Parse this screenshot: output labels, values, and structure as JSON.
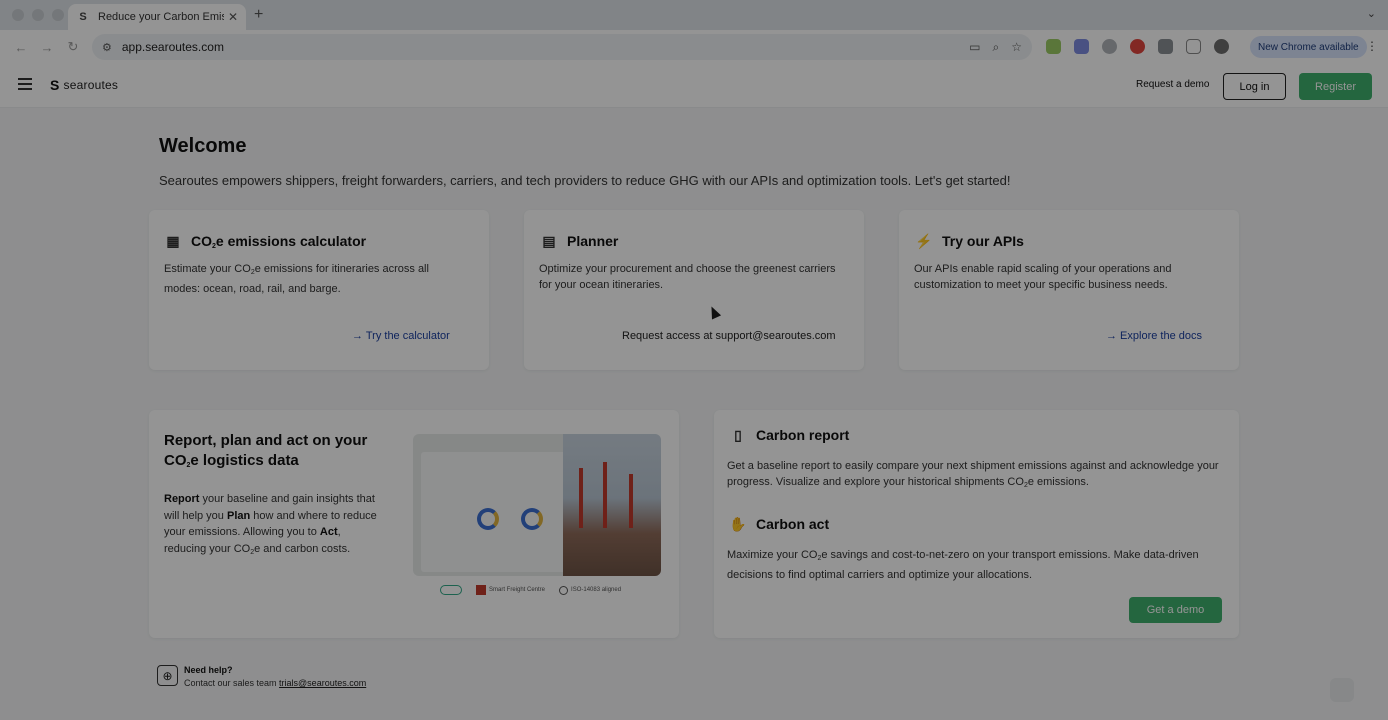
{
  "browser": {
    "tab_title": "Reduce your Carbon Emissio",
    "url": "app.searoutes.com",
    "update_label": "New Chrome available"
  },
  "header": {
    "brand": "searoutes",
    "request_demo": "Request a demo",
    "login": "Log in",
    "register": "Register"
  },
  "main": {
    "title": "Welcome",
    "subtitle": "Searoutes empowers shippers, freight forwarders, carriers, and tech providers to reduce GHG with our APIs and optimization tools. Let's get started!"
  },
  "cards": [
    {
      "title_pre": "CO",
      "title_sub": "2",
      "title_post": "e emissions calculator",
      "desc_pre": "Estimate your CO",
      "desc_sub": "2",
      "desc_post": "e emissions for itineraries across all modes: ocean, road, rail, and barge.",
      "link": "→ Try the calculator"
    },
    {
      "title": "Planner",
      "desc": "Optimize your procurement and choose the greenest carriers for your ocean itineraries.",
      "link": "Request access at support@searoutes.com"
    },
    {
      "title": "Try our APIs",
      "desc": "Our APIs enable rapid scaling of your operations and customization to meet your specific business needs.",
      "link": "→ Explore the docs"
    }
  ],
  "report_section": {
    "title_pre": "Report, plan and act on your CO",
    "title_sub": "2",
    "title_post": "e logistics data",
    "body_b1": "Report",
    "body_t1": " your baseline and gain insights that will help you ",
    "body_b2": "Plan",
    "body_t2": " how and where to reduce your emissions. Allowing you to ",
    "body_b3": "Act",
    "body_t3": ", reducing your CO",
    "body_sub": "2",
    "body_t4": "e and carbon costs.",
    "badges": [
      "Smart Freight Centre",
      "ISO-14083 aligned"
    ]
  },
  "carbon_report": {
    "title": "Carbon report",
    "desc_pre": "Get a baseline report to easily compare your next shipment emissions against and acknowledge your progress. Visualize and explore your historical shipments CO",
    "desc_sub": "2",
    "desc_post": "e emissions."
  },
  "carbon_act": {
    "title": "Carbon act",
    "desc_pre": "Maximize your CO",
    "desc_sub": "2",
    "desc_post": "e savings and cost-to-net-zero on your transport emissions. Make data-driven decisions to find optimal carriers and optimize your allocations.",
    "button": "Get a demo"
  },
  "help": {
    "title": "Need help?",
    "text": "Contact our sales team ",
    "email": "trials@searoutes.com"
  },
  "colors": {
    "accent_green": "#3eb06d",
    "link_blue": "#1b3fa0"
  }
}
